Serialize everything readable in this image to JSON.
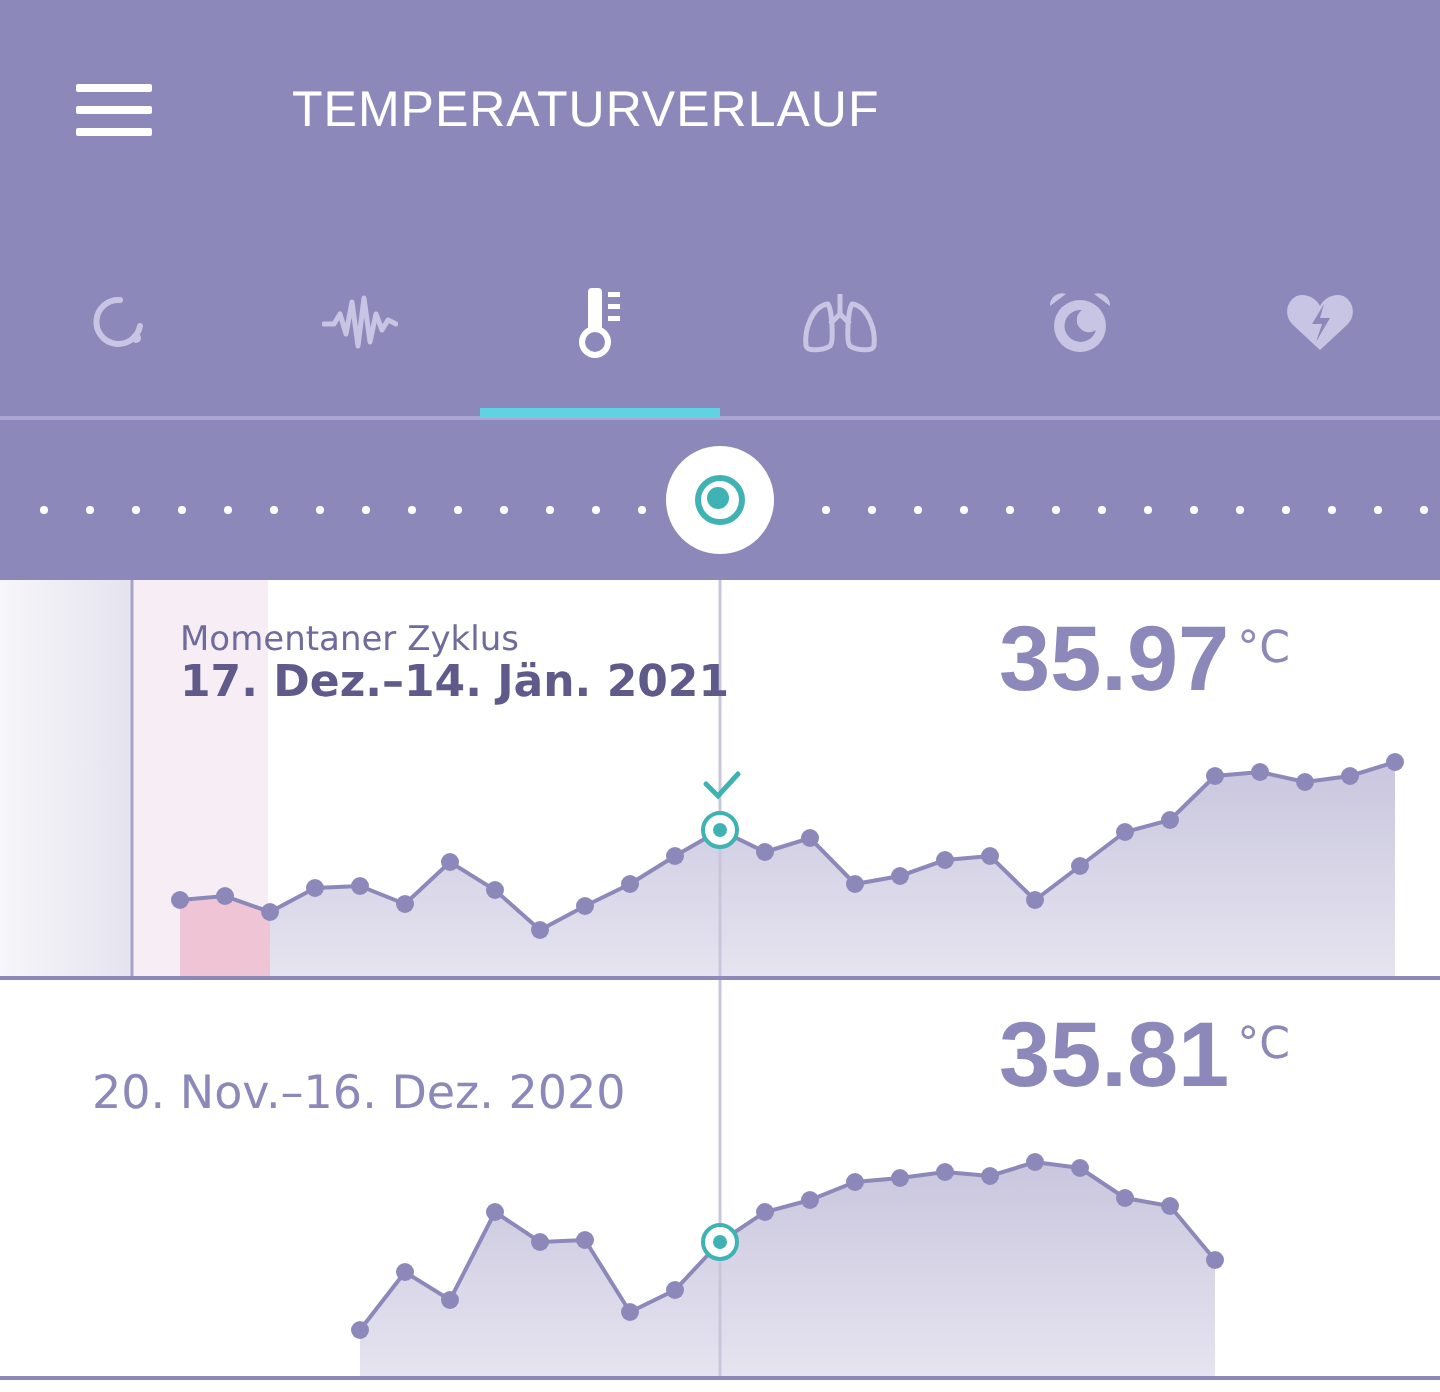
{
  "header": {
    "title": "TEMPERATURVERLAUF"
  },
  "tabs": [
    {
      "selected": false
    },
    {
      "selected": false
    },
    {
      "selected": true
    },
    {
      "selected": false
    },
    {
      "selected": false
    },
    {
      "selected": false
    }
  ],
  "cycles": [
    {
      "label": "Momentaner Zyklus",
      "dates": "17. Dez.–14. Jän. 2021",
      "current": true,
      "temperature": "35.97",
      "unit": "°C"
    },
    {
      "dates": "20. Nov.–16. Dez. 2020",
      "current": false,
      "temperature": "35.81",
      "unit": "°C"
    }
  ]
}
